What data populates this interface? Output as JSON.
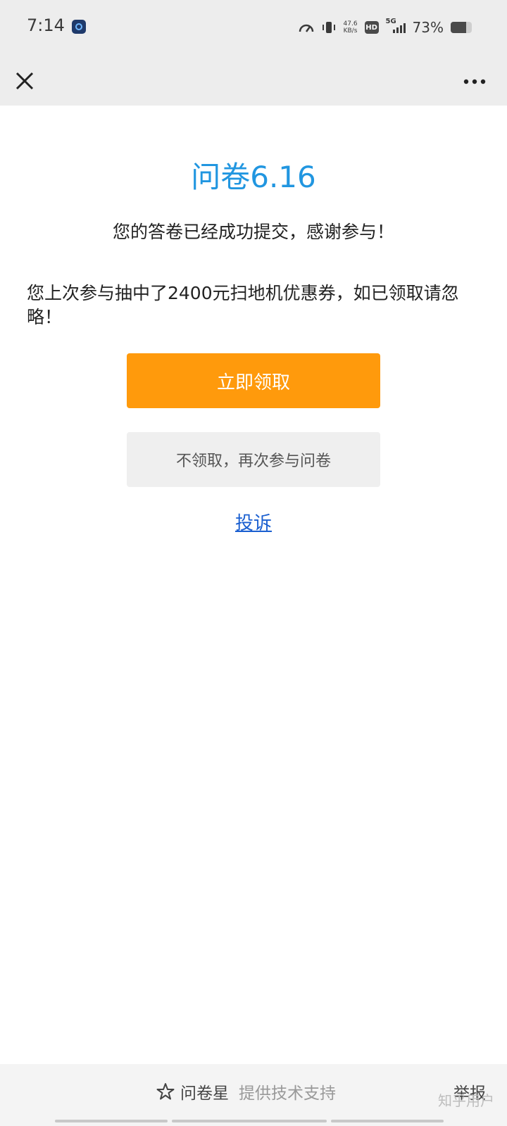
{
  "status_bar": {
    "time": "7:14",
    "net_speed_value": "47.6",
    "net_speed_unit": "KB/s",
    "hd_label": "HD",
    "network_label": "5G",
    "battery_percent_text": "73%",
    "battery_level": 0.73
  },
  "nav": {
    "close_icon": "close-icon",
    "more_icon": "more-icon"
  },
  "main": {
    "title": "问卷6.16",
    "success_message": "您的答卷已经成功提交，感谢参与！",
    "prize_message": "您上次参与抽中了2400元扫地机优惠券，如已领取请忽略！",
    "claim_button_label": "立即领取",
    "decline_button_label": "不领取，再次参与问卷",
    "complaint_link_label": "投诉"
  },
  "footer": {
    "brand": "问卷星",
    "support_text": "提供技术支持",
    "report_label": "举报",
    "watermark": "知乎用户"
  },
  "colors": {
    "title": "#2196e0",
    "claim_button": "#ff9a0c",
    "link": "#1a5fd0"
  }
}
